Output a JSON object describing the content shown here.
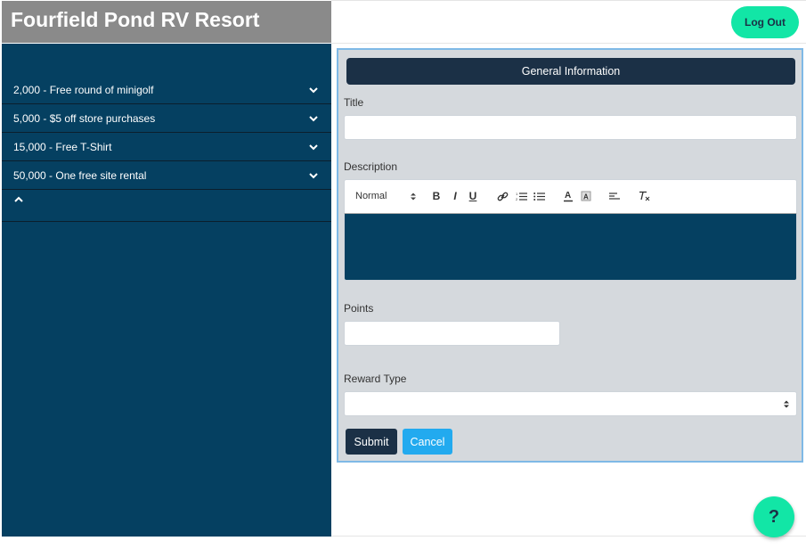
{
  "header": {
    "title": "Fourfield Pond RV Resort",
    "logout_label": "Log Out"
  },
  "sidebar": {
    "rewards": [
      {
        "label": "2,000 - Free round of minigolf"
      },
      {
        "label": "5,000 - $5 off store purchases"
      },
      {
        "label": "15,000 - Free T-Shirt"
      },
      {
        "label": "50,000 - One free site rental"
      }
    ]
  },
  "form": {
    "section_title": "General Information",
    "title_label": "Title",
    "title_value": "",
    "description_label": "Description",
    "editor": {
      "format_value": "Normal",
      "icons": [
        "bold-icon",
        "italic-icon",
        "underline-icon",
        "link-icon",
        "ordered-list-icon",
        "bullet-list-icon",
        "text-color-icon",
        "background-color-icon",
        "align-icon",
        "clear-format-icon"
      ]
    },
    "points_label": "Points",
    "points_value": "",
    "reward_type_label": "Reward Type",
    "reward_type_value": "",
    "submit_label": "Submit",
    "cancel_label": "Cancel"
  },
  "help": {
    "label": "?"
  },
  "colors": {
    "sidebar": "#054061",
    "accent": "#12e6a6",
    "dark": "#1b3046",
    "cancel": "#22aaef"
  }
}
